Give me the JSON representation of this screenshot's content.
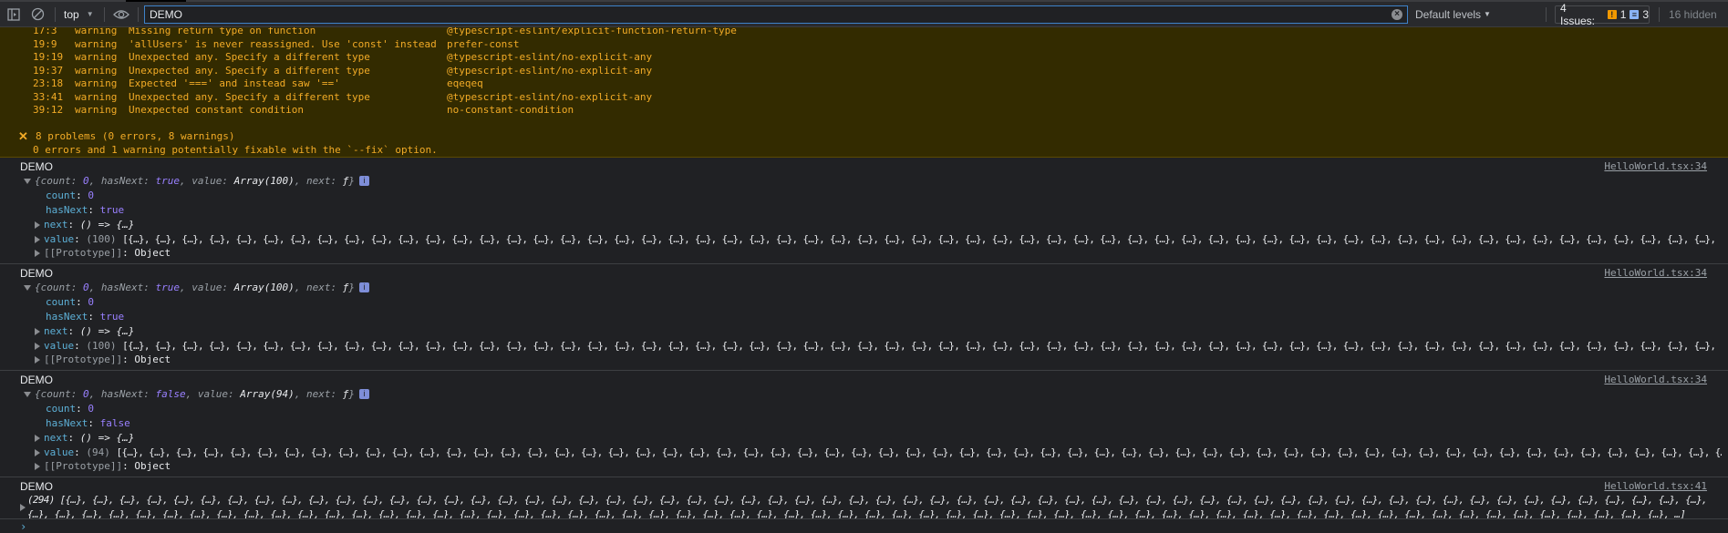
{
  "toolbar": {
    "context": "top",
    "filter_value": "DEMO",
    "levels": "Default levels",
    "issues_label": "4 Issues:",
    "issues_warning_count": "1",
    "issues_info_count": "3",
    "hidden": "16 hidden"
  },
  "lint": {
    "rows": [
      {
        "pos": "17:3",
        "level": "warning",
        "message": "Missing return type on function",
        "rule": "@typescript-eslint/explicit-function-return-type"
      },
      {
        "pos": "19:9",
        "level": "warning",
        "message": "'allUsers' is never reassigned. Use 'const' instead",
        "rule": "prefer-const"
      },
      {
        "pos": "19:19",
        "level": "warning",
        "message": "Unexpected any. Specify a different type",
        "rule": "@typescript-eslint/no-explicit-any"
      },
      {
        "pos": "19:37",
        "level": "warning",
        "message": "Unexpected any. Specify a different type",
        "rule": "@typescript-eslint/no-explicit-any"
      },
      {
        "pos": "23:18",
        "level": "warning",
        "message": "Expected '===' and instead saw '=='",
        "rule": "eqeqeq"
      },
      {
        "pos": "33:41",
        "level": "warning",
        "message": "Unexpected any. Specify a different type",
        "rule": "@typescript-eslint/no-explicit-any"
      },
      {
        "pos": "39:12",
        "level": "warning",
        "message": "Unexpected constant condition",
        "rule": "no-constant-condition"
      }
    ],
    "summary": "8 problems (0 errors, 8 warnings)",
    "fixable": "0 errors and 1 warning potentially fixable with the `--fix` option."
  },
  "messages": [
    {
      "label": "DEMO",
      "source": "HelloWorld.tsx:34",
      "preview": {
        "count": "0",
        "hasNext": "true",
        "value": "Array(100)",
        "next": "ƒ"
      },
      "props": {
        "count": "0",
        "hasNext": "true",
        "next": "() => {…}",
        "value_len": "(100)",
        "value_items": "[{…}, {…}, {…}, {…}, {…}, {…}, {…}, {…}, {…}, {…}, {…}, {…}, {…}, {…}, {…}, {…}, {…}, {…}, {…}, {…}, {…}, {…}, {…}, {…}, {…}, {…}, {…}, {…}, {…}, {…}, {…}, {…}, {…}, {…}, {…}, {…}, {…}, {…}, {…}, {…}, {…}, {…}, {…}, {…}, {…}, {…}, {…}, {…}, {…}, {…}, {…}, {…}, {…}, {…}, {…}, {…}, {…}, {…}, {…}, {…}",
        "prototype": "Object"
      }
    },
    {
      "label": "DEMO",
      "source": "HelloWorld.tsx:34",
      "preview": {
        "count": "0",
        "hasNext": "true",
        "value": "Array(100)",
        "next": "ƒ"
      },
      "props": {
        "count": "0",
        "hasNext": "true",
        "next": "() => {…}",
        "value_len": "(100)",
        "value_items": "[{…}, {…}, {…}, {…}, {…}, {…}, {…}, {…}, {…}, {…}, {…}, {…}, {…}, {…}, {…}, {…}, {…}, {…}, {…}, {…}, {…}, {…}, {…}, {…}, {…}, {…}, {…}, {…}, {…}, {…}, {…}, {…}, {…}, {…}, {…}, {…}, {…}, {…}, {…}, {…}, {…}, {…}, {…}, {…}, {…}, {…}, {…}, {…}, {…}, {…}, {…}, {…}, {…}, {…}, {…}, {…}, {…}, {…}, {…}, {…}",
        "prototype": "Object"
      }
    },
    {
      "label": "DEMO",
      "source": "HelloWorld.tsx:34",
      "preview": {
        "count": "0",
        "hasNext": "false",
        "value": "Array(94)",
        "next": "ƒ"
      },
      "props": {
        "count": "0",
        "hasNext": "false",
        "next": "() => {…}",
        "value_len": "(94)",
        "value_items": "[{…}, {…}, {…}, {…}, {…}, {…}, {…}, {…}, {…}, {…}, {…}, {…}, {…}, {…}, {…}, {…}, {…}, {…}, {…}, {…}, {…}, {…}, {…}, {…}, {…}, {…}, {…}, {…}, {…}, {…}, {…}, {…}, {…}, {…}, {…}, {…}, {…}, {…}, {…}, {…}, {…}, {…}, {…}, {…}, {…}, {…}, {…}, {…}, {…}, {…}, {…}, {…}, {…}, {…}, {…}, {…}, {…}, {…}, {…}, {…}",
        "prototype": "Object"
      }
    },
    {
      "label": "DEMO",
      "source": "HelloWorld.tsx:41",
      "array_len": "(294)",
      "line1": "[{…}, {…}, {…}, {…}, {…}, {…}, {…}, {…}, {…}, {…}, {…}, {…}, {…}, {…}, {…}, {…}, {…}, {…}, {…}, {…}, {…}, {…}, {…}, {…}, {…}, {…}, {…}, {…}, {…}, {…}, {…}, {…}, {…}, {…}, {…}, {…}, {…}, {…}, {…}, {…}, {…}, {…}, {…}, {…}, {…}, {…}, {…}, {…}, {…}, {…}, {…}, {…}, {…}, {…}, {…}, {…}, {…}, {…}, {…}, {…}, {…},",
      "line2": "{…}, {…}, {…}, {…}, {…}, {…}, {…}, {…}, {…}, {…}, {…}, {…}, {…}, {…}, {…}, {…}, {…}, {…}, {…}, {…}, {…}, {…}, {…}, {…}, {…}, {…}, {…}, {…}, {…}, {…}, {…}, {…}, {…}, {…}, {…}, {…}, {…}, {…}, {…}, {…}, {…}, {…}, {…}, {…}, {…}, {…}, {…}, {…}, {…}, {…}, {…}, {…}, {…}, {…}, {…}, {…}, {…}, {…}, {…}, {…}, {…}, …]"
    }
  ],
  "colors": {
    "warning_bg": "#332b00",
    "warning_text": "#f2ab26",
    "key": "#5db0d7",
    "primitive": "#9980ff",
    "background": "#202124"
  }
}
